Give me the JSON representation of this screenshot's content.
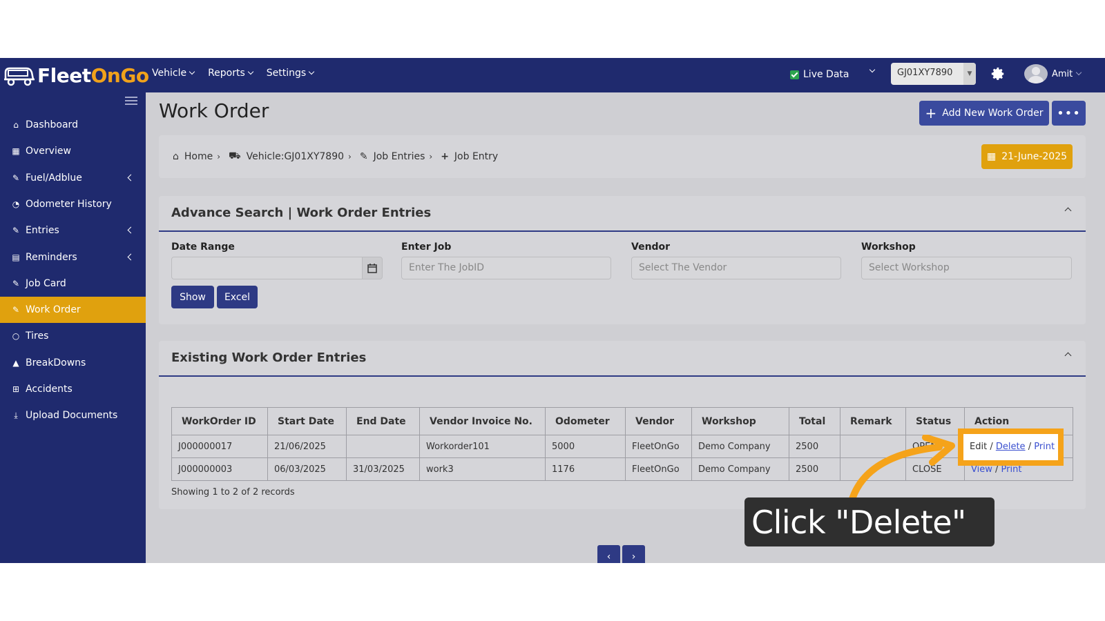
{
  "app": {
    "logo_text_fleet": "Fleet",
    "logo_text_ongo": "OnGo",
    "top_nav": [
      "Vehicle",
      "Reports",
      "Settings"
    ],
    "live_data_label": "Live Data",
    "vehicle_select_value": "GJ01XY7890",
    "user_name": "Amit"
  },
  "sidebar": {
    "items": [
      {
        "label": "Dashboard",
        "icon": "home-icon"
      },
      {
        "label": "Overview",
        "icon": "grid-icon"
      },
      {
        "label": "Fuel/Adblue",
        "icon": "edit-icon",
        "has_submenu": true
      },
      {
        "label": "Odometer History",
        "icon": "gauge-icon"
      },
      {
        "label": "Entries",
        "icon": "edit-icon",
        "has_submenu": true
      },
      {
        "label": "Reminders",
        "icon": "calendar-icon",
        "has_submenu": true
      },
      {
        "label": "Job Card",
        "icon": "edit-icon"
      },
      {
        "label": "Work Order",
        "icon": "edit-icon",
        "active": true
      },
      {
        "label": "Tires",
        "icon": "circle-icon"
      },
      {
        "label": "BreakDowns",
        "icon": "warning-icon"
      },
      {
        "label": "Accidents",
        "icon": "plus-square-icon"
      },
      {
        "label": "Upload Documents",
        "icon": "download-icon"
      }
    ]
  },
  "page": {
    "title": "Work Order",
    "add_button": "Add New Work Order",
    "more_button": "•••"
  },
  "breadcrumb": {
    "items": [
      "Home",
      "Vehicle:GJ01XY7890",
      "Job Entries",
      "Job Entry"
    ],
    "date": "21-June-2025"
  },
  "advance_search": {
    "title": "Advance Search | Work Order Entries",
    "date_range_label": "Date Range",
    "date_range_value": "",
    "job_label": "Enter Job",
    "job_placeholder": "Enter The JobID",
    "vendor_label": "Vendor",
    "vendor_placeholder": "Select The Vendor",
    "workshop_label": "Workshop",
    "workshop_placeholder": "Select Workshop",
    "show_button": "Show",
    "excel_button": "Excel"
  },
  "existing": {
    "title": "Existing Work Order Entries",
    "columns": [
      "WorkOrder ID",
      "Start Date",
      "End Date",
      "Vendor Invoice No.",
      "Odometer",
      "Vendor",
      "Workshop",
      "Total",
      "Remark",
      "Status",
      "Action"
    ],
    "rows": [
      {
        "id": "J000000017",
        "start": "21/06/2025",
        "end": "",
        "invoice": "Workorder101",
        "odometer": "5000",
        "vendor": "FleetOnGo",
        "workshop": "Demo Company",
        "total": "2500",
        "remark": "",
        "status": "OPEN",
        "action_edit": "Edit",
        "action_delete": "Delete",
        "action_print": "Print"
      },
      {
        "id": "J000000003",
        "start": "06/03/2025",
        "end": "31/03/2025",
        "invoice": "work3",
        "odometer": "1176",
        "vendor": "FleetOnGo",
        "workshop": "Demo Company",
        "total": "2500",
        "remark": "",
        "status": "CLOSE",
        "action_view": "View",
        "action_print": "Print"
      }
    ],
    "records_text": "Showing 1 to 2 of 2 records",
    "pager_prev": "‹",
    "pager_next": "›"
  },
  "callout": {
    "text": "Click \"Delete\"",
    "accent_color": "#f5a31a"
  },
  "colors": {
    "navbar": "#1f2a6e",
    "active_item": "#e0a10e",
    "button_blue": "#2e3a84"
  }
}
